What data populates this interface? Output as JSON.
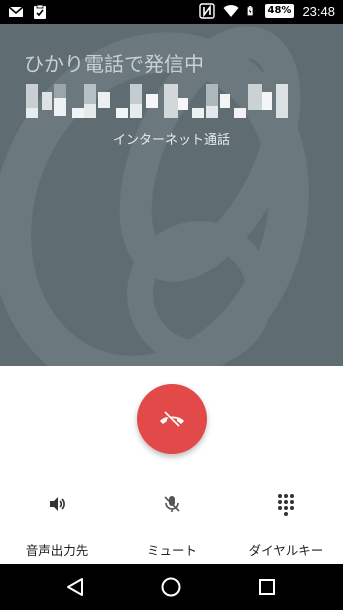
{
  "status_bar": {
    "left_icons": [
      "gmail-icon",
      "clipboard-check-icon"
    ],
    "right_icons": [
      "nfc-icon",
      "wifi-icon",
      "battery-charging-icon"
    ],
    "battery": "48%",
    "time": "23:48"
  },
  "call": {
    "status": "ひかり電話で発信中",
    "type": "インターネット通話"
  },
  "end_call": {
    "icon": "end-call-icon",
    "color": "#e24a4a"
  },
  "actions": [
    {
      "label": "音声出力先",
      "icon": "speaker-icon"
    },
    {
      "label": "ミュート",
      "icon": "mic-off-icon"
    },
    {
      "label": "ダイヤルキー",
      "icon": "dialpad-icon"
    }
  ],
  "nav": {
    "icons": [
      "back-icon",
      "home-icon",
      "recents-icon"
    ]
  },
  "colors": {
    "header_bg": "#5f6d72",
    "accent_red": "#e24a4a"
  }
}
